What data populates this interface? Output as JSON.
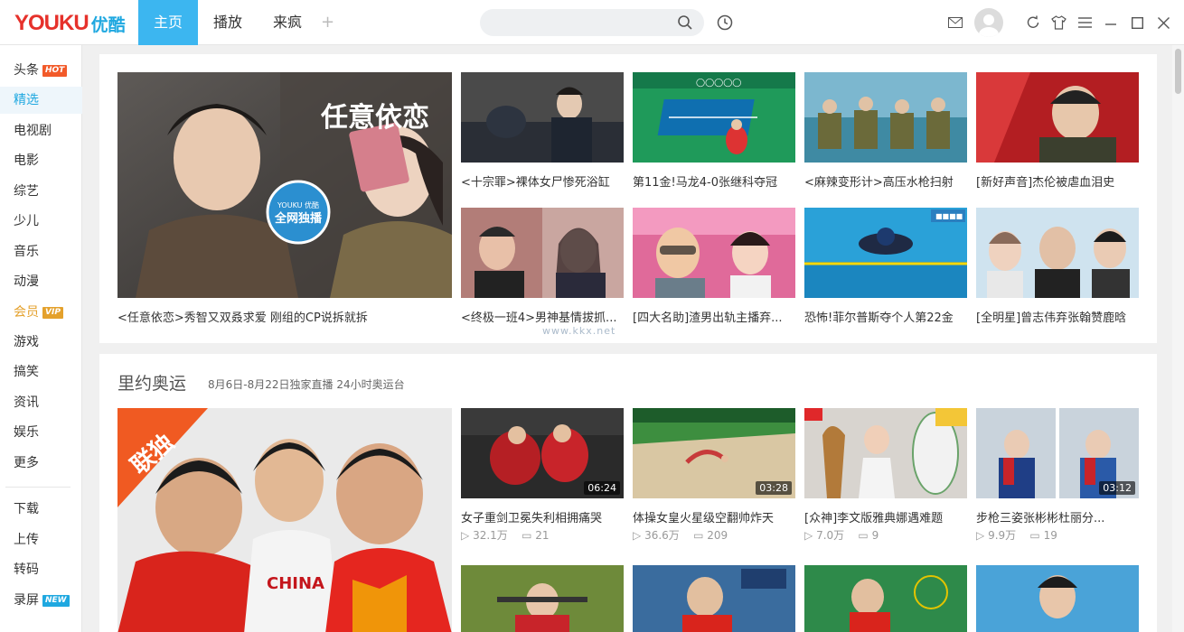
{
  "header": {
    "logo_text": "YOUKU",
    "logo_cn": "优酷",
    "tabs": [
      {
        "label": "主页",
        "active": true
      },
      {
        "label": "播放",
        "active": false
      },
      {
        "label": "来疯",
        "active": false
      }
    ],
    "add_tab": "+",
    "search_placeholder": ""
  },
  "sidebar": {
    "items": [
      {
        "label": "头条",
        "badge": "HOT",
        "badge_color": "#f25a29"
      },
      {
        "label": "精选",
        "active": true
      },
      {
        "label": "电视剧"
      },
      {
        "label": "电影"
      },
      {
        "label": "综艺"
      },
      {
        "label": "少儿"
      },
      {
        "label": "音乐"
      },
      {
        "label": "动漫"
      },
      {
        "label": "会员",
        "badge": "VIP",
        "badge_color": "#e4a12c"
      },
      {
        "label": "游戏"
      },
      {
        "label": "搞笑"
      },
      {
        "label": "资讯"
      },
      {
        "label": "娱乐"
      },
      {
        "label": "更多"
      }
    ],
    "tools": [
      {
        "label": "下载"
      },
      {
        "label": "上传"
      },
      {
        "label": "转码"
      },
      {
        "label": "录屏",
        "badge": "NEW",
        "badge_color": "#1fa8e0"
      }
    ]
  },
  "featured": {
    "main": {
      "caption": "<任意依恋>秀智又双叒求爱 刚组的CP说拆就拆",
      "overlay_title": "任意依恋",
      "overlay_badge": "全网独播"
    },
    "items": [
      {
        "caption": "<十宗罪>裸体女尸惨死浴缸"
      },
      {
        "caption": "第11金!马龙4-0张继科夺冠"
      },
      {
        "caption": "<麻辣变形计>高压水枪扫射"
      },
      {
        "caption": "[新好声音]杰伦被虐血泪史"
      },
      {
        "caption": "<终极一班4>男神基情拔抓..."
      },
      {
        "caption": "[四大名助]渣男出轨主播弃..."
      },
      {
        "caption": "恐怖!菲尔普斯夺个人第22金"
      },
      {
        "caption": "[全明星]曾志伟弃张翰赞鹿晗"
      }
    ]
  },
  "olympics": {
    "title": "里约奥运",
    "subtitle": "8月6日-8月22日独家直播 24小时奥运台",
    "main_badge": "联独",
    "items": [
      {
        "caption": "女子重剑卫冕失利相拥痛哭",
        "duration": "06:24",
        "plays": "32.1万",
        "comments": "21"
      },
      {
        "caption": "体操女皇火星级空翻帅炸天",
        "duration": "03:28",
        "plays": "36.6万",
        "comments": "209"
      },
      {
        "caption": "[众神]李文版雅典娜遇难题",
        "duration": "",
        "plays": "7.0万",
        "comments": "9"
      },
      {
        "caption": "步枪三姿张彬彬杜丽分...",
        "duration": "03:12",
        "plays": "9.9万",
        "comments": "19"
      }
    ]
  },
  "watermark": "www.kkx.net"
}
